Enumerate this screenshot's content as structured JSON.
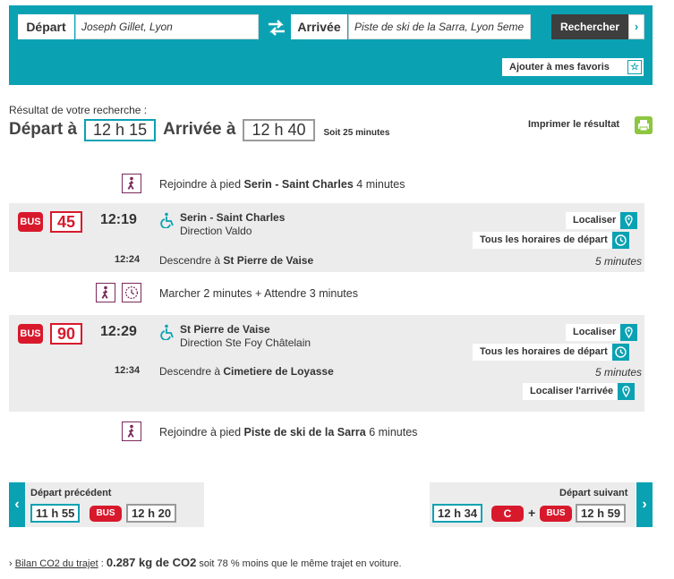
{
  "search": {
    "depart_label": "Départ",
    "depart_value": "Joseph Gillet, Lyon",
    "arrivee_label": "Arrivée",
    "arrivee_value": "Piste de ski de la Sarra, Lyon 5eme",
    "search_button": "Rechercher",
    "search_arrow": "›",
    "favorites_button": "Ajouter à mes favoris",
    "favorites_icon": "☆"
  },
  "result": {
    "caption": "Résultat de votre recherche :",
    "depart_label": "Départ à",
    "depart_time": "12 h 15",
    "arrivee_label": "Arrivée à",
    "arrivee_time": "12 h 40",
    "duration": "Soit 25 minutes",
    "print_label": "Imprimer le résultat"
  },
  "journey": {
    "walk_start": {
      "prefix": "Rejoindre à pied",
      "place": "Serin - Saint Charles",
      "suffix": "4 minutes"
    },
    "legs": [
      {
        "mode": "BUS",
        "line": "45",
        "dep_time": "12:19",
        "arr_time": "12:24",
        "stop": "Serin - Saint Charles",
        "direction": "Direction Valdo",
        "alight_prefix": "Descendre à",
        "alight_stop": "St Pierre de Vaise",
        "duration": "5 minutes",
        "btn_locate": "Localiser",
        "btn_schedule": "Tous les horaires de départ"
      },
      {
        "mode": "BUS",
        "line": "90",
        "dep_time": "12:29",
        "arr_time": "12:34",
        "stop": "St Pierre de Vaise",
        "direction": "Direction Ste Foy Châtelain",
        "alight_prefix": "Descendre à",
        "alight_stop": "Cimetiere de Loyasse",
        "duration": "5 minutes",
        "btn_locate": "Localiser",
        "btn_schedule": "Tous les horaires de départ",
        "btn_locate_arrival": "Localiser l'arrivée"
      }
    ],
    "transfer": "Marcher 2 minutes + Attendre 3 minutes",
    "walk_end": {
      "prefix": "Rejoindre à pied",
      "place": "Piste de ski de la Sarra",
      "suffix": "6 minutes"
    }
  },
  "nav": {
    "prev_title": "Départ précédent",
    "prev_time_dep": "11 h 55",
    "prev_mode": "BUS",
    "prev_time_arr": "12 h 20",
    "next_title": "Départ suivant",
    "next_time_dep": "12 h 34",
    "next_mode_1": "C",
    "next_plus": "+",
    "next_mode_2": "BUS",
    "next_time_arr": "12 h 59",
    "prev_arrow": "‹",
    "next_arrow": "›"
  },
  "co2": {
    "prefix": "›",
    "link": "Bilan CO2 du trajet",
    "colon": " :",
    "value": "0.287 kg de CO2",
    "suffix": "soit 78 % moins que le même trajet en voiture."
  },
  "colors": {
    "accent": "#0aa2b3",
    "bus_red": "#d8192c",
    "walk_purple": "#7a2a5a",
    "print_green": "#8dc63f"
  }
}
